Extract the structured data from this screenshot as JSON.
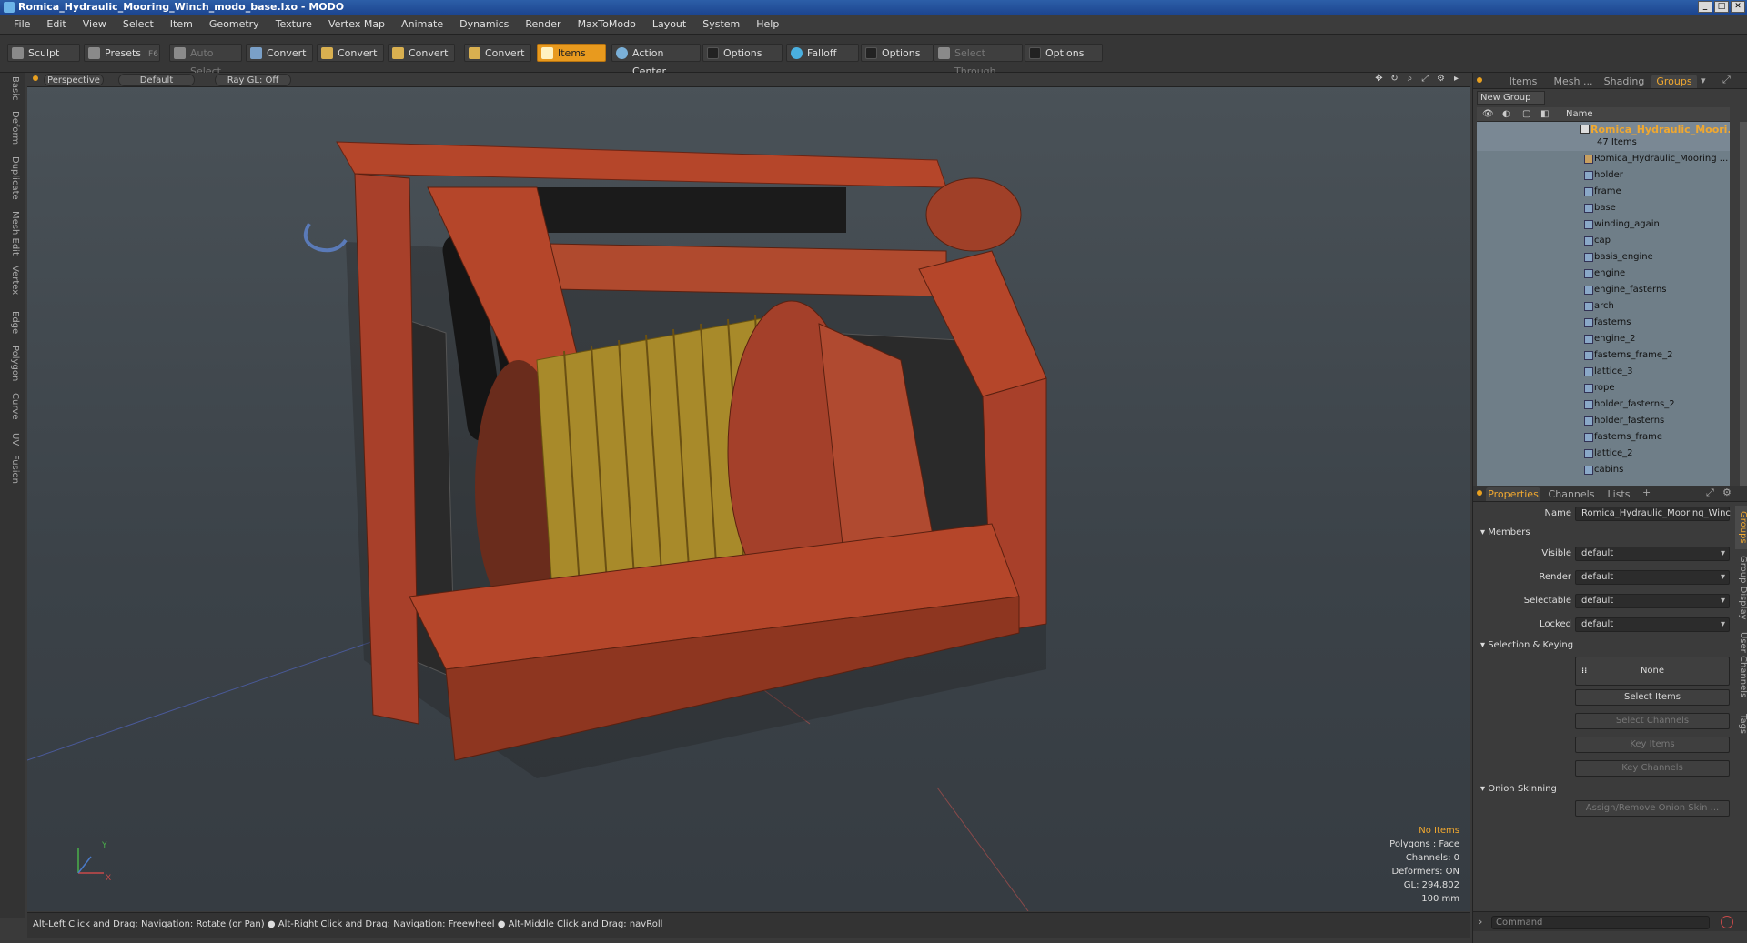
{
  "window": {
    "title": "Romica_Hydraulic_Mooring_Winch_modo_base.lxo - MODO"
  },
  "menu": [
    "File",
    "Edit",
    "View",
    "Select",
    "Item",
    "Geometry",
    "Texture",
    "Vertex Map",
    "Animate",
    "Dynamics",
    "Render",
    "MaxToModo",
    "Layout",
    "System",
    "Help"
  ],
  "toolbar": {
    "sculpt": "Sculpt",
    "presets": "Presets",
    "presets_key": "F6",
    "auto_select": "Auto Select",
    "convert1": "Convert",
    "convert2": "Convert",
    "convert3": "Convert",
    "convert4": "Convert",
    "items": "Items",
    "action_center": "Action Center",
    "options1": "Options",
    "falloff": "Falloff",
    "options2": "Options",
    "select_through": "Select Through",
    "options3": "Options"
  },
  "left_tabs": [
    "Basic",
    "Deform",
    "Duplicate",
    "Mesh Edit",
    "Vertex",
    "Edge",
    "Polygon",
    "Curve",
    "UV",
    "Fusion"
  ],
  "viewport": {
    "view": "Perspective",
    "shading": "Default",
    "raygl": "Ray GL: Off"
  },
  "stats": {
    "items": "No Items",
    "polygons": "Polygons : Face",
    "channels": "Channels: 0",
    "deformers": "Deformers: ON",
    "gl": "GL: 294,802",
    "scale": "100 mm"
  },
  "status": {
    "hint1": "Alt-Left Click and Drag: Navigation: Rotate (or Pan)",
    "hint2": "Alt-Right Click and Drag: Navigation: Freewheel",
    "hint3": "Alt-Middle Click and Drag: navRoll"
  },
  "panel_tabs": {
    "items": "Items",
    "mesh": "Mesh ...",
    "shading": "Shading",
    "groups": "Groups"
  },
  "groups": {
    "new_group": "New Group",
    "name_header": "Name",
    "group_name": "Romica_Hydraulic_Moori...",
    "group_count": "47 Items",
    "items": [
      "Romica_Hydraulic_Mooring ...",
      "holder",
      "frame",
      "base",
      "winding_again",
      "cap",
      "basis_engine",
      "engine",
      "engine_fasterns",
      "arch",
      "fasterns",
      "engine_2",
      "fasterns_frame_2",
      "lattice_3",
      "rope",
      "holder_fasterns_2",
      "holder_fasterns",
      "fasterns_frame",
      "lattice_2",
      "cabins"
    ]
  },
  "prop_tabs": {
    "properties": "Properties",
    "channels": "Channels",
    "lists": "Lists"
  },
  "props": {
    "name_label": "Name",
    "name_value": "Romica_Hydraulic_Mooring_Winc",
    "members": "Members",
    "visible_label": "Visible",
    "visible": "default",
    "render_label": "Render",
    "render": "default",
    "selectable_label": "Selectable",
    "selectable": "default",
    "locked_label": "Locked",
    "locked": "default",
    "selection_keying": "Selection & Keying",
    "none": "None",
    "select_items": "Select Items",
    "select_channels": "Select Channels",
    "key_items": "Key Items",
    "key_channels": "Key Channels",
    "onion_skinning": "Onion Skinning",
    "assign_onion": "Assign/Remove Onion Skin ..."
  },
  "side_tabs": [
    "Groups",
    "Group Display",
    "User Channels",
    "Tags"
  ],
  "command": {
    "placeholder": "Command"
  }
}
